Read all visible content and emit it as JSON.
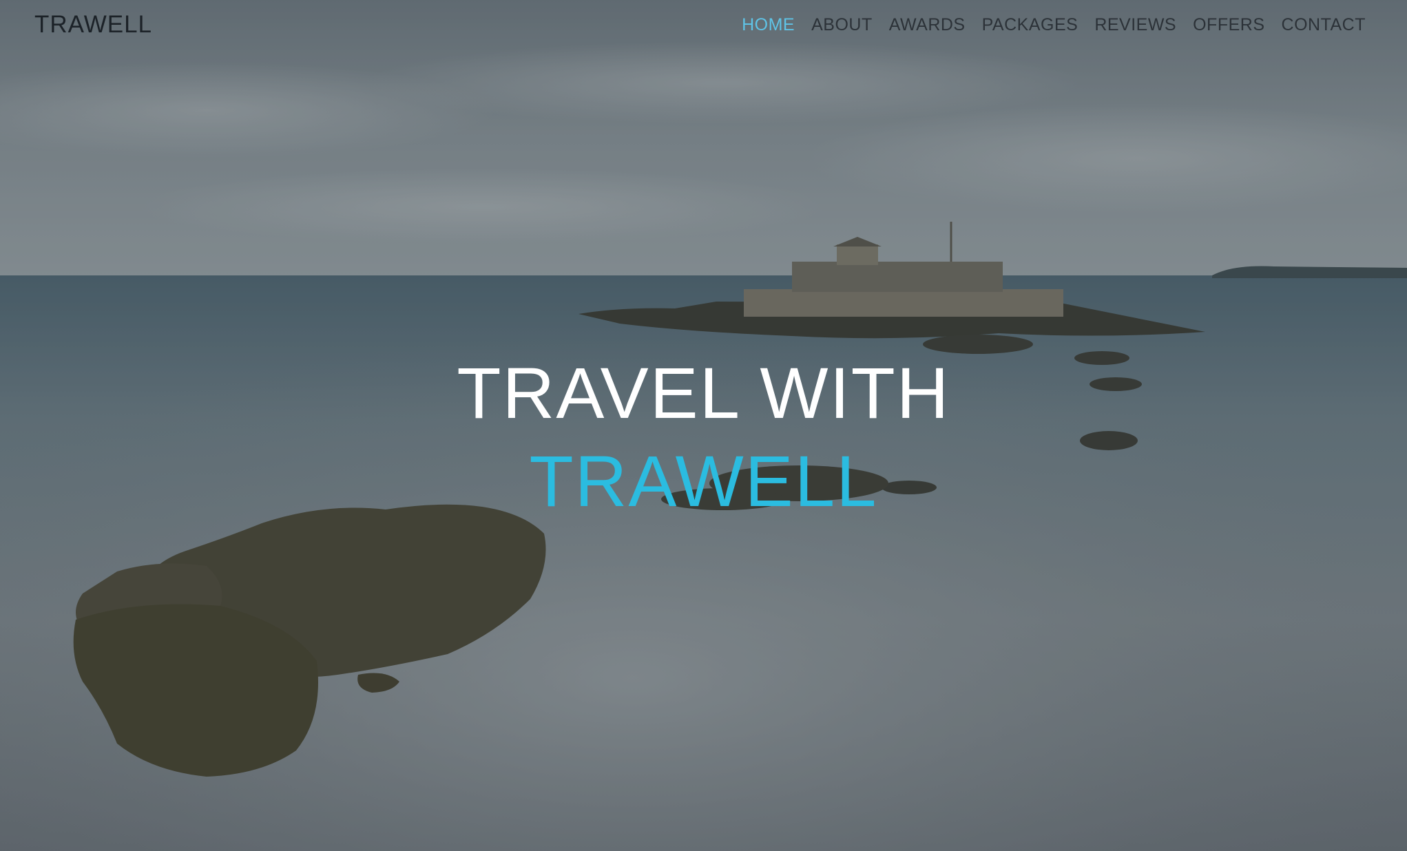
{
  "brand": {
    "name": "TRAWELL"
  },
  "nav": {
    "items": [
      {
        "label": "HOME",
        "active": true
      },
      {
        "label": "ABOUT",
        "active": false
      },
      {
        "label": "AWARDS",
        "active": false
      },
      {
        "label": "PACKAGES",
        "active": false
      },
      {
        "label": "REVIEWS",
        "active": false
      },
      {
        "label": "OFFERS",
        "active": false
      },
      {
        "label": "CONTACT",
        "active": false
      }
    ]
  },
  "hero": {
    "line1": "TRAVEL WITH",
    "line2": "TRAWELL",
    "background": "long-exposure-sea-fortress-photo"
  },
  "colors": {
    "accent": "#2bbce0",
    "nav_active": "#5fc3e6",
    "nav_text": "#2c3238",
    "headline_text": "#ffffff"
  }
}
